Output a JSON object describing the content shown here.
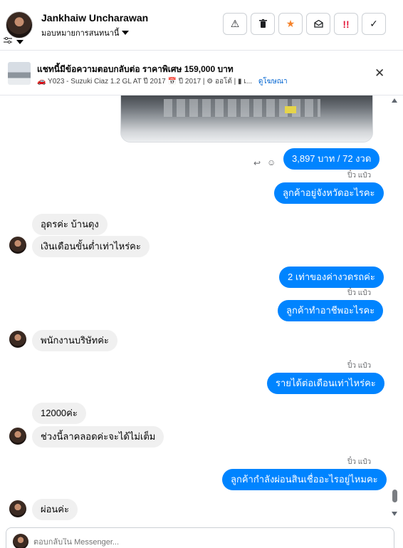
{
  "header": {
    "contact_name": "Jankhaiw Uncharawan",
    "assign_label": "มอบหมายการสนทนานี้",
    "actions": [
      {
        "name": "report-icon",
        "glyph": "⚠"
      },
      {
        "name": "trash-icon",
        "glyph": "🗑"
      },
      {
        "name": "star-icon",
        "glyph": "★"
      },
      {
        "name": "mark-unread-icon",
        "glyph": "✉"
      },
      {
        "name": "spam-icon",
        "glyph": "!!"
      },
      {
        "name": "done-check-icon",
        "glyph": "✓"
      }
    ]
  },
  "ad": {
    "title": "แชทนี้มีข้อความตอบกลับต่อ ราคาพิเศษ 159,000 บาท",
    "subtitle": "🚗 Y023 - Suzuki Ciaz 1.2 GL AT ปี 2017 📅 ปี 2017 | ⚙ ออโต้ | ▮ เ...",
    "link": "ดูโฆษณา"
  },
  "messages": {
    "m1": "3,897 บาท / 72 งวด",
    "seen1": "ปิ๋ว แป๋ว",
    "m2": "ลูกค้าอยู่จังหวัดอะไรคะ",
    "m3": "อุดรค่ะ บ้านดุง",
    "m4": "เงินเดือนขั้นต่ำเท่าไหร่คะ",
    "m5": "2 เท่าของค่างวดรถค่ะ",
    "seen2": "ปิ๋ว แป๋ว",
    "m6": "ลูกค้าทำอาชีพอะไรคะ",
    "m7": "พนักงานบริษัทค่ะ",
    "seen3": "ปิ๋ว แป๋ว",
    "m8": "รายได้ต่อเดือนเท่าไหร่คะ",
    "m9": "12000ค่ะ",
    "m10": "ช่วงนี้ลาคลอดค่ะจะได้ไม่เต็ม",
    "seen4": "ปิ๋ว แป๋ว",
    "m11": "ลูกค้ากำลังผ่อนสินเชื่ออะไรอยู่ไหมคะ",
    "m12": "ผ่อนค่ะ"
  },
  "composer": {
    "placeholder": "ตอบกลับใน Messenger..."
  },
  "colors": {
    "outgoing": "#0084ff",
    "incoming": "#f0f0f0"
  }
}
